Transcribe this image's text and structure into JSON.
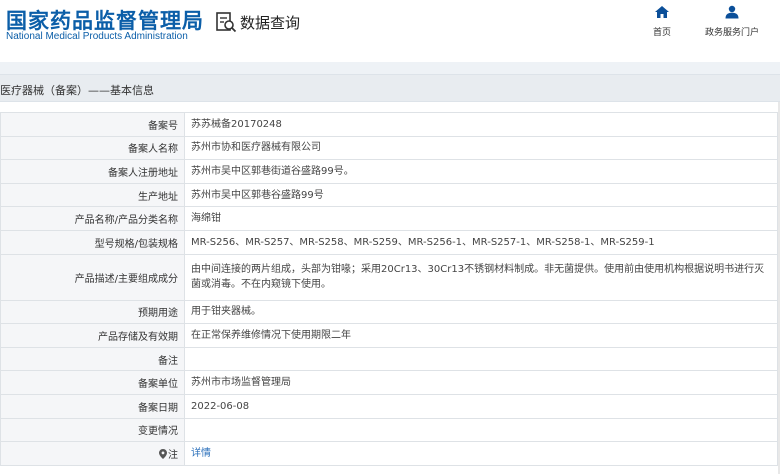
{
  "header": {
    "brand_cn": "国家药品监督管理局",
    "brand_en": "National Medical Products Administration",
    "query_label": "数据查询",
    "nav": [
      {
        "label": "首页",
        "icon": "home-icon"
      },
      {
        "label": "政务服务门户",
        "icon": "user-icon"
      }
    ]
  },
  "breadcrumb": "医疗器械（备案）——基本信息",
  "rows": [
    {
      "label": "备案号",
      "value": "苏苏械备20170248"
    },
    {
      "label": "备案人名称",
      "value": "苏州市协和医疗器械有限公司"
    },
    {
      "label": "备案人注册地址",
      "value": "苏州市吴中区郭巷街道谷盛路99号。"
    },
    {
      "label": "生产地址",
      "value": "苏州市吴中区郭巷谷盛路99号"
    },
    {
      "label": "产品名称/产品分类名称",
      "value": "海绵钳"
    },
    {
      "label": "型号规格/包装规格",
      "value": "MR-S256、MR-S257、MR-S258、MR-S259、MR-S256-1、MR-S257-1、MR-S258-1、MR-S259-1"
    },
    {
      "label": "产品描述/主要组成成分",
      "value": "由中间连接的两片组成，头部为钳喙；采用20Cr13、30Cr13不锈钢材料制成。非无菌提供。使用前由使用机构根据说明书进行灭菌或消毒。不在内窥镜下使用。"
    },
    {
      "label": "预期用途",
      "value": "用于钳夹器械。"
    },
    {
      "label": "产品存储及有效期",
      "value": "在正常保养维修情况下使用期限二年"
    },
    {
      "label": "备注",
      "value": ""
    },
    {
      "label": "备案单位",
      "value": "苏州市市场监督管理局"
    },
    {
      "label": "备案日期",
      "value": "2022-06-08"
    },
    {
      "label": "变更情况",
      "value": ""
    },
    {
      "label": "注",
      "value": "详情"
    }
  ],
  "colors": {
    "brand_blue": "#0b5ea8",
    "label_bg": "#f5f6f8",
    "border": "#dee2e6",
    "link": "#2a6fba"
  }
}
